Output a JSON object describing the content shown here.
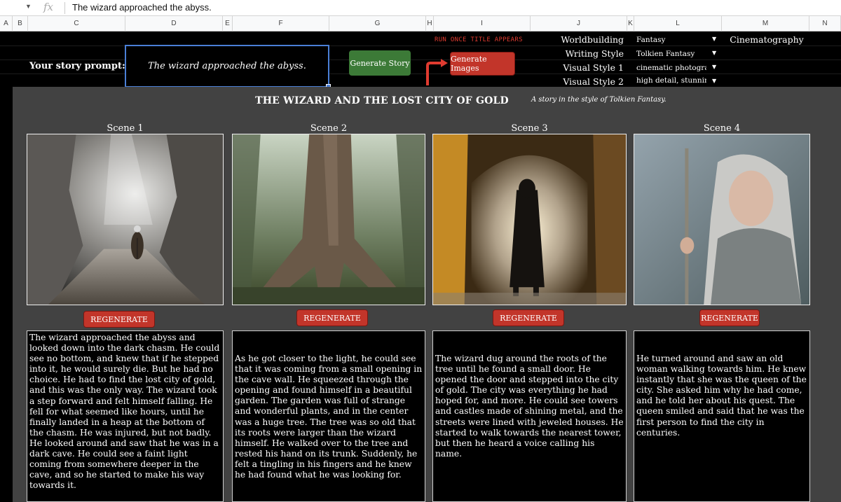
{
  "formula_bar": {
    "fx_label": "fx",
    "value": "The wizard approached the abyss."
  },
  "columns": [
    "A",
    "B",
    "C",
    "D",
    "E",
    "F",
    "G",
    "H",
    "I",
    "J",
    "K",
    "L",
    "M",
    "N"
  ],
  "prompt": {
    "label": "Your story prompt:",
    "value": "The wizard approached the abyss."
  },
  "buttons": {
    "generate_story": "Generate Story",
    "generate_images": "Generate Images",
    "regenerate": "REGENERATE"
  },
  "run_once": "RUN ONCE TITLE APPEARS",
  "settings": [
    {
      "key": "Worldbuilding",
      "value": "Fantasy"
    },
    {
      "key": "Writing Style",
      "value": "Tolkien Fantasy"
    },
    {
      "key": "Visual Style 1",
      "value": "cinematic photograph"
    },
    {
      "key": "Visual Style 2",
      "value": "high detail, stunning c"
    }
  ],
  "cinematography": "Cinematography",
  "story": {
    "title": "THE WIZARD AND THE LOST CITY OF GOLD",
    "subtitle": "A story in the style of Tolkien Fantasy."
  },
  "scenes": [
    {
      "label": "Scene 1",
      "image_icon": "cave-wizard-image",
      "text": "The wizard approached the abyss and looked down into the dark chasm. He could see no bottom, and knew that if he stepped into it, he would surely die. But he had no choice. He had to find the lost city of gold, and this was the only way. The wizard took a step forward and felt himself falling. He fell for what seemed like hours, until he finally landed in a heap at the bottom of the chasm. He was injured, but not badly. He looked around and saw that he was in a dark cave. He could see a faint light coming from somewhere deeper in the cave, and so he started to make his way towards it."
    },
    {
      "label": "Scene 2",
      "image_icon": "giant-tree-roots-image",
      "text": "As he got closer to the light, he could see that it was coming from a small opening in the cave wall. He squeezed through the opening and found himself in a beautiful garden. The garden was full of strange and wonderful plants, and in the center was a huge tree. The tree was so old that its roots were larger than the wizard himself. He walked over to the tree and rested his hand on its trunk. Suddenly, he felt a tingling in his fingers and he knew he had found what he was looking for."
    },
    {
      "label": "Scene 3",
      "image_icon": "hooded-figure-archway-image",
      "text": "The wizard dug around the roots of the tree until he found a small door. He opened the door and stepped into the city of gold. The city was everything he had hoped for, and more. He could see towers and castles made of shining metal, and the streets were lined with jeweled houses. He started to walk towards the nearest tower, but then he heard a voice calling his name."
    },
    {
      "label": "Scene 4",
      "image_icon": "old-woman-staff-image",
      "text": "He turned around and saw an old woman walking towards him. He knew instantly that she was the queen of the city. She asked him why he had come, and he told her about his quest. The queen smiled and said that he was the first person to find the city in centuries."
    }
  ],
  "colors": {
    "accent_red": "#c2352a",
    "accent_green": "#3c7a37",
    "selection_blue": "#4a7fd6",
    "panel": "#424242"
  }
}
